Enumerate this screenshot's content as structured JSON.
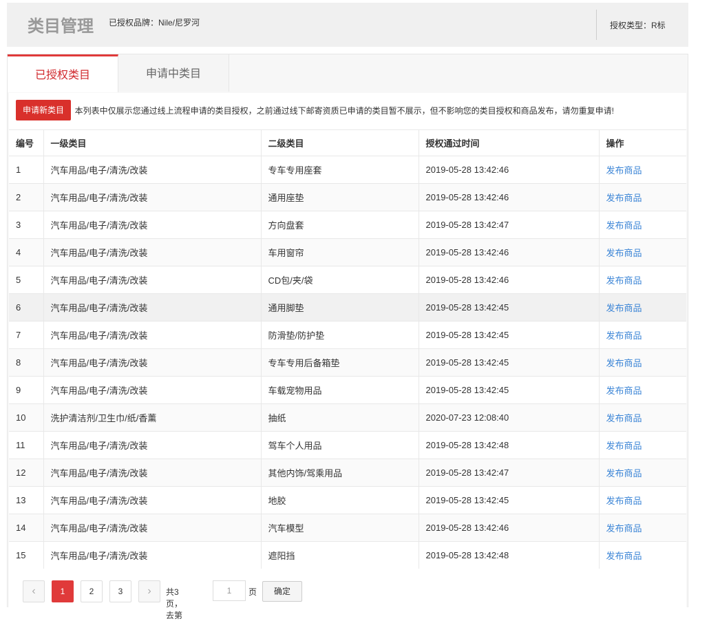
{
  "header": {
    "title": "类目管理",
    "brand": "已授权品牌：Nile/尼罗河",
    "auth_type": "授权类型：R标"
  },
  "tabs": [
    {
      "label": "已授权类目",
      "active": true
    },
    {
      "label": "申请中类目",
      "active": false
    }
  ],
  "notice": {
    "apply_button": "申请新类目",
    "text": "本列表中仅展示您通过线上流程申请的类目授权，之前通过线下邮寄资质已申请的类目暂不展示，但不影响您的类目授权和商品发布，请勿重复申请!"
  },
  "table": {
    "headers": [
      "编号",
      "一级类目",
      "二级类目",
      "授权通过时间",
      "操作"
    ],
    "rows": [
      {
        "no": "1",
        "cat1": "汽车用品/电子/清洗/改装",
        "cat2": "专车专用座套",
        "time": "2019-05-28 13:42:46",
        "action": "发布商品"
      },
      {
        "no": "2",
        "cat1": "汽车用品/电子/清洗/改装",
        "cat2": "通用座垫",
        "time": "2019-05-28 13:42:46",
        "action": "发布商品"
      },
      {
        "no": "3",
        "cat1": "汽车用品/电子/清洗/改装",
        "cat2": "方向盘套",
        "time": "2019-05-28 13:42:47",
        "action": "发布商品"
      },
      {
        "no": "4",
        "cat1": "汽车用品/电子/清洗/改装",
        "cat2": "车用窗帘",
        "time": "2019-05-28 13:42:46",
        "action": "发布商品"
      },
      {
        "no": "5",
        "cat1": "汽车用品/电子/清洗/改装",
        "cat2": "CD包/夹/袋",
        "time": "2019-05-28 13:42:46",
        "action": "发布商品"
      },
      {
        "no": "6",
        "cat1": "汽车用品/电子/清洗/改装",
        "cat2": "通用脚垫",
        "time": "2019-05-28 13:42:45",
        "action": "发布商品"
      },
      {
        "no": "7",
        "cat1": "汽车用品/电子/清洗/改装",
        "cat2": "防滑垫/防护垫",
        "time": "2019-05-28 13:42:45",
        "action": "发布商品"
      },
      {
        "no": "8",
        "cat1": "汽车用品/电子/清洗/改装",
        "cat2": "专车专用后备箱垫",
        "time": "2019-05-28 13:42:45",
        "action": "发布商品"
      },
      {
        "no": "9",
        "cat1": "汽车用品/电子/清洗/改装",
        "cat2": "车载宠物用品",
        "time": "2019-05-28 13:42:45",
        "action": "发布商品"
      },
      {
        "no": "10",
        "cat1": "洗护清洁剂/卫生巾/纸/香薰",
        "cat2": "抽纸",
        "time": "2020-07-23 12:08:40",
        "action": "发布商品"
      },
      {
        "no": "11",
        "cat1": "汽车用品/电子/清洗/改装",
        "cat2": "驾车个人用品",
        "time": "2019-05-28 13:42:48",
        "action": "发布商品"
      },
      {
        "no": "12",
        "cat1": "汽车用品/电子/清洗/改装",
        "cat2": "其他内饰/驾乘用品",
        "time": "2019-05-28 13:42:47",
        "action": "发布商品"
      },
      {
        "no": "13",
        "cat1": "汽车用品/电子/清洗/改装",
        "cat2": "地胶",
        "time": "2019-05-28 13:42:45",
        "action": "发布商品"
      },
      {
        "no": "14",
        "cat1": "汽车用品/电子/清洗/改装",
        "cat2": "汽车模型",
        "time": "2019-05-28 13:42:46",
        "action": "发布商品"
      },
      {
        "no": "15",
        "cat1": "汽车用品/电子/清洗/改装",
        "cat2": "遮阳挡",
        "time": "2019-05-28 13:42:48",
        "action": "发布商品"
      }
    ]
  },
  "pager": {
    "prev": "‹",
    "pages": [
      "1",
      "2",
      "3"
    ],
    "current": "1",
    "next": "›",
    "total_text": "共3页，去第",
    "input_value": "1",
    "page_unit": "页",
    "confirm": "确定"
  },
  "colors": {
    "accent": "#e03a3a",
    "link": "#3a84d6"
  }
}
